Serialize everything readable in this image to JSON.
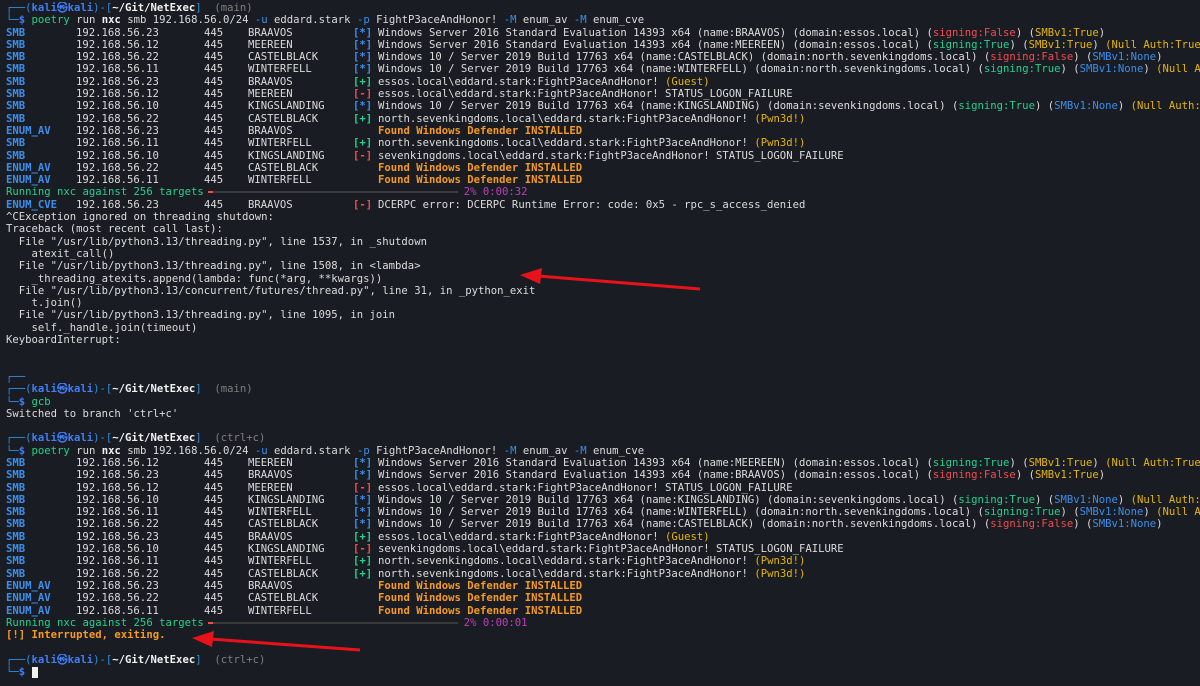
{
  "prompt1": {
    "user": "kali",
    "at": "㉿",
    "host": "kali",
    "path": "~/Git/NetExec",
    "branch": "main"
  },
  "cmd1": [
    "poetry",
    "run",
    "nxc",
    "smb",
    "192.168.56.0/24",
    "-u",
    "eddard.stark",
    "-p",
    "FightP3aceAndHonor!",
    "-M",
    "enum_av",
    "-M",
    "enum_cve"
  ],
  "block1": [
    {
      "proto": "SMB",
      "ip": "192.168.56.23",
      "port": "445",
      "host": "BRAAVOS",
      "flag": "[*]",
      "parts": [
        [
          "Windows Server 2016 Standard Evaluation 14393 x64 (name:BRAAVOS) (domain:essos.local) (",
          "plain"
        ],
        [
          "signing:False",
          "red"
        ],
        [
          ") (",
          "plain"
        ],
        [
          "SMBv1:True",
          "yellow"
        ],
        [
          ")",
          "plain"
        ]
      ]
    },
    {
      "proto": "SMB",
      "ip": "192.168.56.12",
      "port": "445",
      "host": "MEEREEN",
      "flag": "[*]",
      "parts": [
        [
          "Windows Server 2016 Standard Evaluation 14393 x64 (name:MEEREEN) (domain:essos.local) (",
          "plain"
        ],
        [
          "signing:True",
          "green"
        ],
        [
          ") (",
          "plain"
        ],
        [
          "SMBv1:True",
          "yellow"
        ],
        [
          ") ",
          "plain"
        ],
        [
          "(Null Auth:True)",
          "yellow"
        ]
      ]
    },
    {
      "proto": "SMB",
      "ip": "192.168.56.22",
      "port": "445",
      "host": "CASTELBLACK",
      "flag": "[*]",
      "parts": [
        [
          "Windows 10 / Server 2019 Build 17763 x64 (name:CASTELBLACK) (domain:north.sevenkingdoms.local) (",
          "plain"
        ],
        [
          "signing:False",
          "red"
        ],
        [
          ") (",
          "plain"
        ],
        [
          "SMBv1:None",
          "blue"
        ],
        [
          ")",
          "plain"
        ]
      ]
    },
    {
      "proto": "SMB",
      "ip": "192.168.56.11",
      "port": "445",
      "host": "WINTERFELL",
      "flag": "[*]",
      "parts": [
        [
          "Windows 10 / Server 2019 Build 17763 x64 (name:WINTERFELL) (domain:north.sevenkingdoms.local) (",
          "plain"
        ],
        [
          "signing:True",
          "green"
        ],
        [
          ") (",
          "plain"
        ],
        [
          "SMBv1:None",
          "blue"
        ],
        [
          ") ",
          "plain"
        ],
        [
          "(Null Auth:True)",
          "yellow"
        ]
      ]
    },
    {
      "proto": "SMB",
      "ip": "192.168.56.23",
      "port": "445",
      "host": "BRAAVOS",
      "flag": "[+]",
      "parts": [
        [
          "essos.local\\eddard.stark:FightP3aceAndHonor! ",
          "plain"
        ],
        [
          "(Guest)",
          "yellow"
        ]
      ]
    },
    {
      "proto": "SMB",
      "ip": "192.168.56.12",
      "port": "445",
      "host": "MEEREEN",
      "flag": "[-]",
      "parts": [
        [
          "essos.local\\eddard.stark:FightP3aceAndHonor! STATUS_LOGON_FAILURE",
          "plain"
        ]
      ]
    },
    {
      "proto": "SMB",
      "ip": "192.168.56.10",
      "port": "445",
      "host": "KINGSLANDING",
      "flag": "[*]",
      "parts": [
        [
          "Windows 10 / Server 2019 Build 17763 x64 (name:KINGSLANDING) (domain:sevenkingdoms.local) (",
          "plain"
        ],
        [
          "signing:True",
          "green"
        ],
        [
          ") (",
          "plain"
        ],
        [
          "SMBv1:None",
          "blue"
        ],
        [
          ") ",
          "plain"
        ],
        [
          "(Null Auth:True)",
          "yellow"
        ]
      ]
    },
    {
      "proto": "SMB",
      "ip": "192.168.56.22",
      "port": "445",
      "host": "CASTELBLACK",
      "flag": "[+]",
      "parts": [
        [
          "north.sevenkingdoms.local\\eddard.stark:FightP3aceAndHonor! ",
          "plain"
        ],
        [
          "(Pwn3d!)",
          "yellow"
        ]
      ]
    },
    {
      "proto": "ENUM_AV",
      "ip": "192.168.56.23",
      "port": "445",
      "host": "BRAAVOS",
      "flag": "",
      "parts": [
        [
          "Found Windows Defender INSTALLED",
          "orange"
        ]
      ]
    },
    {
      "proto": "SMB",
      "ip": "192.168.56.11",
      "port": "445",
      "host": "WINTERFELL",
      "flag": "[+]",
      "parts": [
        [
          "north.sevenkingdoms.local\\eddard.stark:FightP3aceAndHonor! ",
          "plain"
        ],
        [
          "(Pwn3d!)",
          "yellow"
        ]
      ]
    },
    {
      "proto": "SMB",
      "ip": "192.168.56.10",
      "port": "445",
      "host": "KINGSLANDING",
      "flag": "[-]",
      "parts": [
        [
          "sevenkingdoms.local\\eddard.stark:FightP3aceAndHonor! STATUS_LOGON_FAILURE",
          "plain"
        ]
      ]
    },
    {
      "proto": "ENUM_AV",
      "ip": "192.168.56.22",
      "port": "445",
      "host": "CASTELBLACK",
      "flag": "",
      "parts": [
        [
          "Found Windows Defender INSTALLED",
          "orange"
        ]
      ]
    },
    {
      "proto": "ENUM_AV",
      "ip": "192.168.56.11",
      "port": "445",
      "host": "WINTERFELL",
      "flag": "",
      "parts": [
        [
          "Found Windows Defender INSTALLED",
          "orange"
        ]
      ]
    }
  ],
  "progress1": {
    "label": "Running nxc against 256 targets",
    "fraction": 0.02,
    "pct": "2%",
    "time": "0:00:32"
  },
  "block1b": [
    {
      "proto": "ENUM_CVE",
      "ip": "192.168.56.23",
      "port": "445",
      "host": "BRAAVOS",
      "flag": "[-]",
      "parts": [
        [
          "DCERPC error: DCERPC Runtime Error: code: 0x5 - rpc_s_access_denied",
          "plain"
        ]
      ]
    }
  ],
  "traceback": [
    "^CException ignored on threading shutdown:",
    "Traceback (most recent call last):",
    "  File \"/usr/lib/python3.13/threading.py\", line 1537, in _shutdown",
    "    atexit_call()",
    "  File \"/usr/lib/python3.13/threading.py\", line 1508, in <lambda>",
    "    _threading_atexits.append(lambda: func(*arg, **kwargs))",
    "  File \"/usr/lib/python3.13/concurrent/futures/thread.py\", line 31, in _python_exit",
    "    t.join()",
    "  File \"/usr/lib/python3.13/threading.py\", line 1095, in join",
    "    self._handle.join(timeout)",
    "KeyboardInterrupt:"
  ],
  "prompt2": {
    "user": "kali",
    "at": "㉿",
    "host": "kali",
    "path": "~/Git/NetExec",
    "branch": "main"
  },
  "cmd2": "gcb",
  "cmd2_output": "Switched to branch 'ctrl+c'",
  "prompt3": {
    "user": "kali",
    "at": "㉿",
    "host": "kali",
    "path": "~/Git/NetExec",
    "branch": "ctrl+c"
  },
  "cmd3": [
    "poetry",
    "run",
    "nxc",
    "smb",
    "192.168.56.0/24",
    "-u",
    "eddard.stark",
    "-p",
    "FightP3aceAndHonor!",
    "-M",
    "enum_av",
    "-M",
    "enum_cve"
  ],
  "block2": [
    {
      "proto": "SMB",
      "ip": "192.168.56.12",
      "port": "445",
      "host": "MEEREEN",
      "flag": "[*]",
      "parts": [
        [
          "Windows Server 2016 Standard Evaluation 14393 x64 (name:MEEREEN) (domain:essos.local) (",
          "plain"
        ],
        [
          "signing:True",
          "green"
        ],
        [
          ") (",
          "plain"
        ],
        [
          "SMBv1:True",
          "yellow"
        ],
        [
          ") ",
          "plain"
        ],
        [
          "(Null Auth:True)",
          "yellow"
        ]
      ]
    },
    {
      "proto": "SMB",
      "ip": "192.168.56.23",
      "port": "445",
      "host": "BRAAVOS",
      "flag": "[*]",
      "parts": [
        [
          "Windows Server 2016 Standard Evaluation 14393 x64 (name:BRAAVOS) (domain:essos.local) (",
          "plain"
        ],
        [
          "signing:False",
          "red"
        ],
        [
          ") (",
          "plain"
        ],
        [
          "SMBv1:True",
          "yellow"
        ],
        [
          ")",
          "plain"
        ]
      ]
    },
    {
      "proto": "SMB",
      "ip": "192.168.56.12",
      "port": "445",
      "host": "MEEREEN",
      "flag": "[-]",
      "parts": [
        [
          "essos.local\\eddard.stark:FightP3aceAndHonor! STATUS_LOGON_FAILURE",
          "plain"
        ]
      ]
    },
    {
      "proto": "SMB",
      "ip": "192.168.56.10",
      "port": "445",
      "host": "KINGSLANDING",
      "flag": "[*]",
      "parts": [
        [
          "Windows 10 / Server 2019 Build 17763 x64 (name:KINGSLANDING) (domain:sevenkingdoms.local) (",
          "plain"
        ],
        [
          "signing:True",
          "green"
        ],
        [
          ") (",
          "plain"
        ],
        [
          "SMBv1:None",
          "blue"
        ],
        [
          ") ",
          "plain"
        ],
        [
          "(Null Auth:True)",
          "yellow"
        ]
      ]
    },
    {
      "proto": "SMB",
      "ip": "192.168.56.11",
      "port": "445",
      "host": "WINTERFELL",
      "flag": "[*]",
      "parts": [
        [
          "Windows 10 / Server 2019 Build 17763 x64 (name:WINTERFELL) (domain:north.sevenkingdoms.local) (",
          "plain"
        ],
        [
          "signing:True",
          "green"
        ],
        [
          ") (",
          "plain"
        ],
        [
          "SMBv1:None",
          "blue"
        ],
        [
          ") ",
          "plain"
        ],
        [
          "(Null Auth:True)",
          "yellow"
        ]
      ]
    },
    {
      "proto": "SMB",
      "ip": "192.168.56.22",
      "port": "445",
      "host": "CASTELBLACK",
      "flag": "[*]",
      "parts": [
        [
          "Windows 10 / Server 2019 Build 17763 x64 (name:CASTELBLACK) (domain:north.sevenkingdoms.local) (",
          "plain"
        ],
        [
          "signing:False",
          "red"
        ],
        [
          ") (",
          "plain"
        ],
        [
          "SMBv1:None",
          "blue"
        ],
        [
          ")",
          "plain"
        ]
      ]
    },
    {
      "proto": "SMB",
      "ip": "192.168.56.23",
      "port": "445",
      "host": "BRAAVOS",
      "flag": "[+]",
      "parts": [
        [
          "essos.local\\eddard.stark:FightP3aceAndHonor! ",
          "plain"
        ],
        [
          "(Guest)",
          "yellow"
        ]
      ]
    },
    {
      "proto": "SMB",
      "ip": "192.168.56.10",
      "port": "445",
      "host": "KINGSLANDING",
      "flag": "[-]",
      "parts": [
        [
          "sevenkingdoms.local\\eddard.stark:FightP3aceAndHonor! STATUS_LOGON_FAILURE",
          "plain"
        ]
      ]
    },
    {
      "proto": "SMB",
      "ip": "192.168.56.11",
      "port": "445",
      "host": "WINTERFELL",
      "flag": "[+]",
      "parts": [
        [
          "north.sevenkingdoms.local\\eddard.stark:FightP3aceAndHonor! ",
          "plain"
        ],
        [
          "(Pwn3d!)",
          "yellow"
        ]
      ]
    },
    {
      "proto": "SMB",
      "ip": "192.168.56.22",
      "port": "445",
      "host": "CASTELBLACK",
      "flag": "[+]",
      "parts": [
        [
          "north.sevenkingdoms.local\\eddard.stark:FightP3aceAndHonor! ",
          "plain"
        ],
        [
          "(Pwn3d!)",
          "yellow"
        ]
      ]
    },
    {
      "proto": "ENUM_AV",
      "ip": "192.168.56.23",
      "port": "445",
      "host": "BRAAVOS",
      "flag": "",
      "parts": [
        [
          "Found Windows Defender INSTALLED",
          "orange"
        ]
      ]
    },
    {
      "proto": "ENUM_AV",
      "ip": "192.168.56.22",
      "port": "445",
      "host": "CASTELBLACK",
      "flag": "",
      "parts": [
        [
          "Found Windows Defender INSTALLED",
          "orange"
        ]
      ]
    },
    {
      "proto": "ENUM_AV",
      "ip": "192.168.56.11",
      "port": "445",
      "host": "WINTERFELL",
      "flag": "",
      "parts": [
        [
          "Found Windows Defender INSTALLED",
          "orange"
        ]
      ]
    }
  ],
  "progress2": {
    "label": "Running nxc against 256 targets",
    "fraction": 0.02,
    "pct": "2%",
    "time": "0:00:01"
  },
  "interrupt_msg": "[!] Interrupted, exiting.",
  "prompt4": {
    "user": "kali",
    "at": "㉿",
    "host": "kali",
    "path": "~/Git/NetExec",
    "branch": "ctrl+c"
  },
  "colors": {
    "background": "#1a1c23",
    "blue": "#3b8eea",
    "green": "#23d18b",
    "red": "#f14c4c",
    "yellow": "#e5b50a",
    "orange": "#f59a23",
    "magenta": "#bc3fbc",
    "arrow": "#e8121a"
  }
}
